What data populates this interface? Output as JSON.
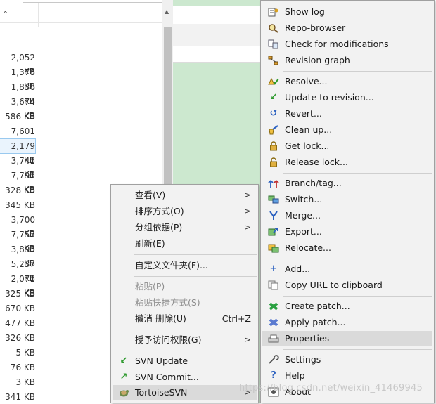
{
  "explorer": {
    "sizes": [
      "2,052 KB",
      "1,378 KB",
      "1,836 KB",
      "3,674 KB",
      "586 KB",
      "7,601 KB",
      "2,179 KB",
      "3,741 KB",
      "7,791 KB",
      "328 KB",
      "345 KB",
      "3,700 KB",
      "7,757 KB",
      "3,893 KB",
      "5,237 KB",
      "2,071 KB",
      "325 KB",
      "670 KB",
      "477 KB",
      "326 KB",
      "5 KB",
      "76 KB",
      "3 KB",
      "341 KB"
    ],
    "selected_index": 6,
    "sort_icon": "chevron-up-icon"
  },
  "context_menu": {
    "items": [
      {
        "label": "查看(V)",
        "submenu": true,
        "disabled": false
      },
      {
        "label": "排序方式(O)",
        "submenu": true,
        "disabled": false
      },
      {
        "label": "分组依据(P)",
        "submenu": true,
        "disabled": false
      },
      {
        "label": "刷新(E)",
        "submenu": false,
        "disabled": false
      },
      {
        "label": "自定义文件夹(F)...",
        "submenu": false,
        "disabled": false
      },
      {
        "label": "粘贴(P)",
        "submenu": false,
        "disabled": true
      },
      {
        "label": "粘贴快捷方式(S)",
        "submenu": false,
        "disabled": true
      },
      {
        "label": "撤消 删除(U)",
        "shortcut": "Ctrl+Z",
        "submenu": false,
        "disabled": false
      },
      {
        "label": "授予访问权限(G)",
        "submenu": true,
        "disabled": false
      },
      {
        "label": "SVN Update",
        "icon": "svn-update-icon",
        "submenu": false,
        "disabled": false
      },
      {
        "label": "SVN Commit...",
        "icon": "svn-commit-icon",
        "submenu": false,
        "disabled": false
      },
      {
        "label": "TortoiseSVN",
        "icon": "tortoise-icon",
        "submenu": true,
        "disabled": false,
        "highlighted": true
      }
    ]
  },
  "svn_menu": {
    "items": [
      {
        "label": "Show log",
        "icon": "show-log-icon"
      },
      {
        "label": "Repo-browser",
        "icon": "repo-browser-icon"
      },
      {
        "label": "Check for modifications",
        "icon": "check-modifications-icon"
      },
      {
        "label": "Revision graph",
        "icon": "revision-graph-icon"
      },
      {
        "label": "Resolve...",
        "icon": "resolve-icon"
      },
      {
        "label": "Update to revision...",
        "icon": "update-to-revision-icon"
      },
      {
        "label": "Revert...",
        "icon": "revert-icon"
      },
      {
        "label": "Clean up...",
        "icon": "clean-up-icon"
      },
      {
        "label": "Get lock...",
        "icon": "lock-icon"
      },
      {
        "label": "Release lock...",
        "icon": "release-lock-icon"
      },
      {
        "label": "Branch/tag...",
        "icon": "branch-tag-icon"
      },
      {
        "label": "Switch...",
        "icon": "switch-icon"
      },
      {
        "label": "Merge...",
        "icon": "merge-icon"
      },
      {
        "label": "Export...",
        "icon": "export-icon"
      },
      {
        "label": "Relocate...",
        "icon": "relocate-icon"
      },
      {
        "label": "Add...",
        "icon": "add-icon"
      },
      {
        "label": "Copy URL to clipboard",
        "icon": "copy-url-icon"
      },
      {
        "label": "Create patch...",
        "icon": "create-patch-icon"
      },
      {
        "label": "Apply patch...",
        "icon": "apply-patch-icon"
      },
      {
        "label": "Properties",
        "icon": "properties-icon",
        "highlighted": true
      },
      {
        "label": "Settings",
        "icon": "settings-icon"
      },
      {
        "label": "Help",
        "icon": "help-icon"
      },
      {
        "label": "About",
        "icon": "about-icon"
      }
    ]
  },
  "watermark": "https://blog.csdn.net/weixin_41469945",
  "colors": {
    "menu_bg": "#f2f2f2",
    "highlight": "#dadada",
    "pane_green": "#cce8cf",
    "selection_border": "#99c9ef"
  }
}
